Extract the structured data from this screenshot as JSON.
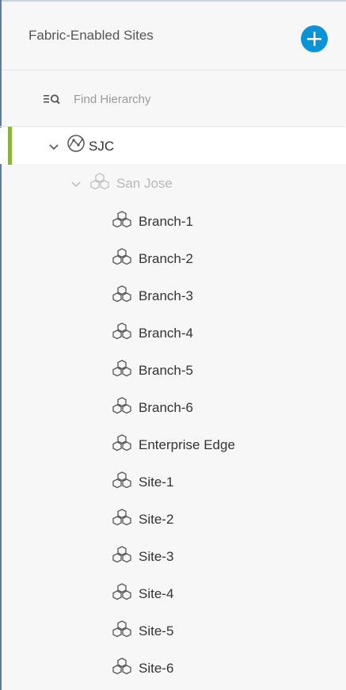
{
  "panel": {
    "title": "Fabric-Enabled Sites",
    "add_button_icon": "plus-circle-icon",
    "accent_color": "#0a94d6",
    "selection_color": "#8cb33e"
  },
  "search": {
    "icon": "filter-search-icon",
    "placeholder": "Find Hierarchy"
  },
  "tree": {
    "root": {
      "label": "SJC",
      "icon": "globe-network-icon",
      "expanded": true,
      "selected": true
    },
    "area": {
      "label": "San Jose",
      "icon": "building-cubes-icon",
      "expanded": true
    },
    "sites": [
      {
        "label": "Branch-1"
      },
      {
        "label": "Branch-2"
      },
      {
        "label": "Branch-3"
      },
      {
        "label": "Branch-4"
      },
      {
        "label": "Branch-5"
      },
      {
        "label": "Branch-6"
      },
      {
        "label": "Enterprise Edge"
      },
      {
        "label": "Site-1"
      },
      {
        "label": "Site-2"
      },
      {
        "label": "Site-3"
      },
      {
        "label": "Site-4"
      },
      {
        "label": "Site-5"
      },
      {
        "label": "Site-6"
      }
    ]
  }
}
